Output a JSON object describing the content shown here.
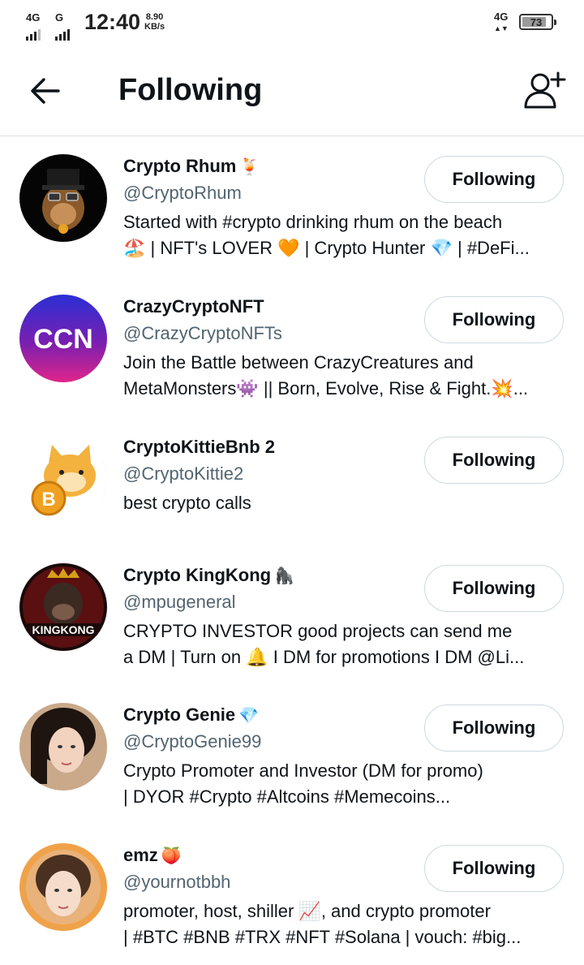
{
  "status_bar": {
    "network_left_1": "4G",
    "network_left_2": "G",
    "time": "12:40",
    "speed_value": "8.90",
    "speed_unit": "KB/s",
    "network_right": "4G",
    "battery": "73"
  },
  "header": {
    "title": "Following",
    "back_icon": "arrow-left-icon",
    "add_icon": "add-user-icon"
  },
  "accounts": [
    {
      "name": "Crypto Rhum",
      "name_emoji": "🍹",
      "handle": "@CryptoRhum",
      "bio_line1": "Started with #crypto drinking rhum on the beach",
      "bio_line2": "🏖️ | NFT's LOVER 🧡 | Crypto Hunter 💎 | #DeFi...",
      "button": "Following"
    },
    {
      "name": "CrazyCryptoNFT",
      "name_emoji": "",
      "handle": "@CrazyCryptoNFTs",
      "bio_line1": "Join the Battle between CrazyCreatures and",
      "bio_line2": "MetaMonsters👾 || Born, Evolve, Rise & Fight.💥...",
      "button": "Following"
    },
    {
      "name": "CryptoKittieBnb 2",
      "name_emoji": "",
      "handle": "@CryptoKittie2",
      "bio_line1": "best crypto calls",
      "bio_line2": "",
      "button": "Following"
    },
    {
      "name": "Crypto KingKong",
      "name_emoji": "🦍",
      "handle": "@mpugeneral",
      "bio_line1": "CRYPTO INVESTOR good projects can send me",
      "bio_line2": "a DM | Turn on 🔔 I DM for promotions I DM @Li...",
      "button": "Following"
    },
    {
      "name": "Crypto Genie",
      "name_emoji": "💎",
      "handle": "@CryptoGenie99",
      "bio_line1": "Crypto Promoter and Investor (DM for promo)",
      "bio_line2": "| DYOR #Crypto #Altcoins #Memecoins...",
      "button": "Following"
    },
    {
      "name": "emz",
      "name_emoji": "🍑",
      "handle": "@yournotbbh",
      "bio_line1": "promoter, host, shiller 📈, and crypto promoter",
      "bio_line2": "| #BTC #BNB #TRX #NFT #Solana | vouch: #big...",
      "button": "Following"
    }
  ],
  "avatar_labels": {
    "ccn": "CCN",
    "kingkong": "KINGKONG",
    "bitcoin": "B"
  }
}
